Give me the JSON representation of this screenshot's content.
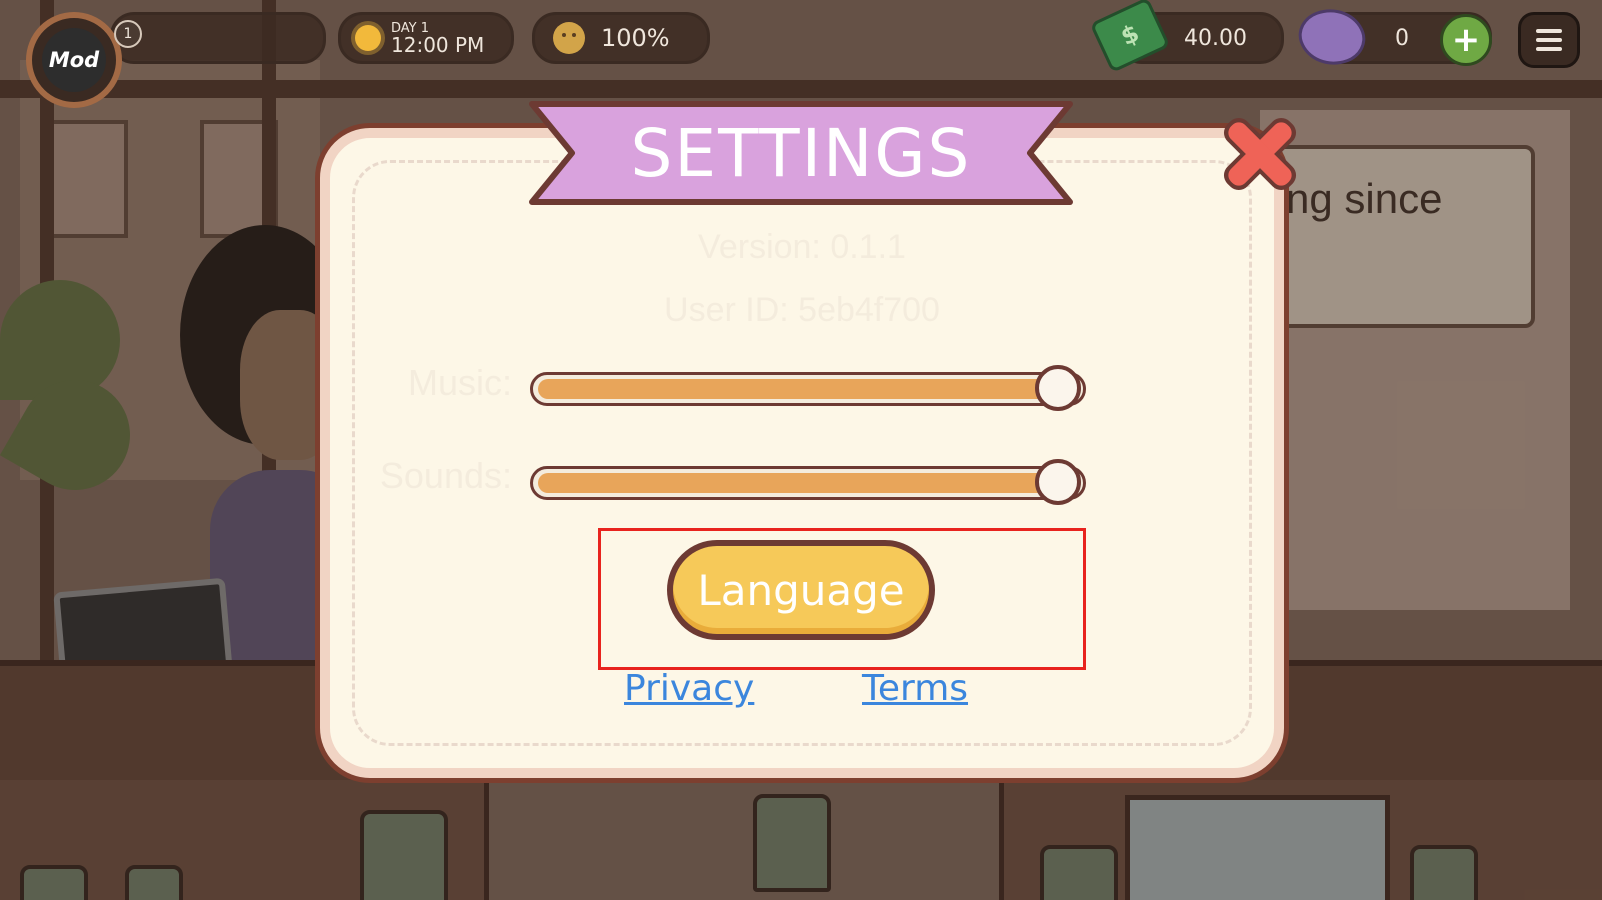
{
  "background": {
    "sign_text": "ng since"
  },
  "hud": {
    "avatar_label": "Mod",
    "level": "1",
    "day_label": "DAY 1",
    "time": "12:00 PM",
    "mood": "100%",
    "cash": "40.00",
    "gems": "0",
    "add_label": "+"
  },
  "settings": {
    "title": "SETTINGS",
    "version": "Version: 0.1.1",
    "user_id": "User ID: 5eb4f700",
    "music_label": "Music:",
    "music_level": 1.0,
    "sounds_label": "Sounds:",
    "sounds_level": 1.0,
    "language_button": "Language",
    "privacy_link": "Privacy",
    "terms_link": "Terms"
  },
  "colors": {
    "ribbon": "#d9a2dd",
    "close": "#ef6357",
    "language_button": "#f6c959",
    "slider_fill": "#e8a55a",
    "link": "#3b86dd",
    "highlight": "#e8231e"
  }
}
